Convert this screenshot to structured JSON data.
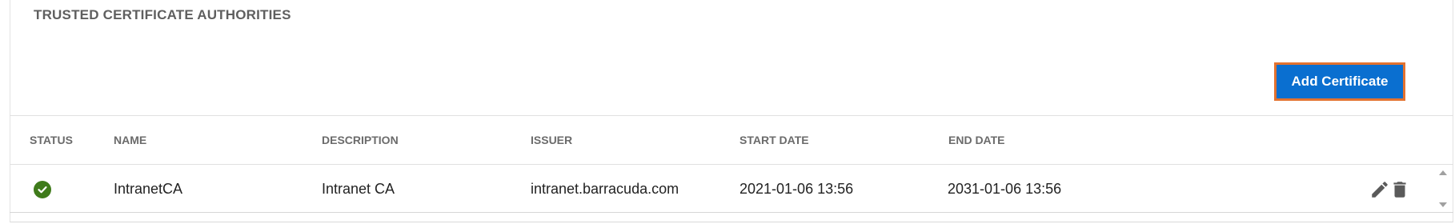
{
  "section": {
    "title": "TRUSTED CERTIFICATE AUTHORITIES"
  },
  "toolbar": {
    "add_label": "Add Certificate"
  },
  "table": {
    "columns": [
      "STATUS",
      "NAME",
      "DESCRIPTION",
      "ISSUER",
      "START DATE",
      "END DATE"
    ],
    "rows": [
      {
        "status": "valid",
        "name": "IntranetCA",
        "description": "Intranet CA",
        "issuer": "intranet.barracuda.com",
        "start_date": "2021-01-06 13:56",
        "end_date": "2031-01-06 13:56"
      }
    ]
  },
  "icons": {
    "status": "check-circle-icon",
    "edit": "pencil-icon",
    "delete": "trash-icon"
  },
  "colors": {
    "primary_button": "#0a6fd0",
    "button_focus_border": "#e3722f",
    "status_ok": "#3f7b1b"
  }
}
